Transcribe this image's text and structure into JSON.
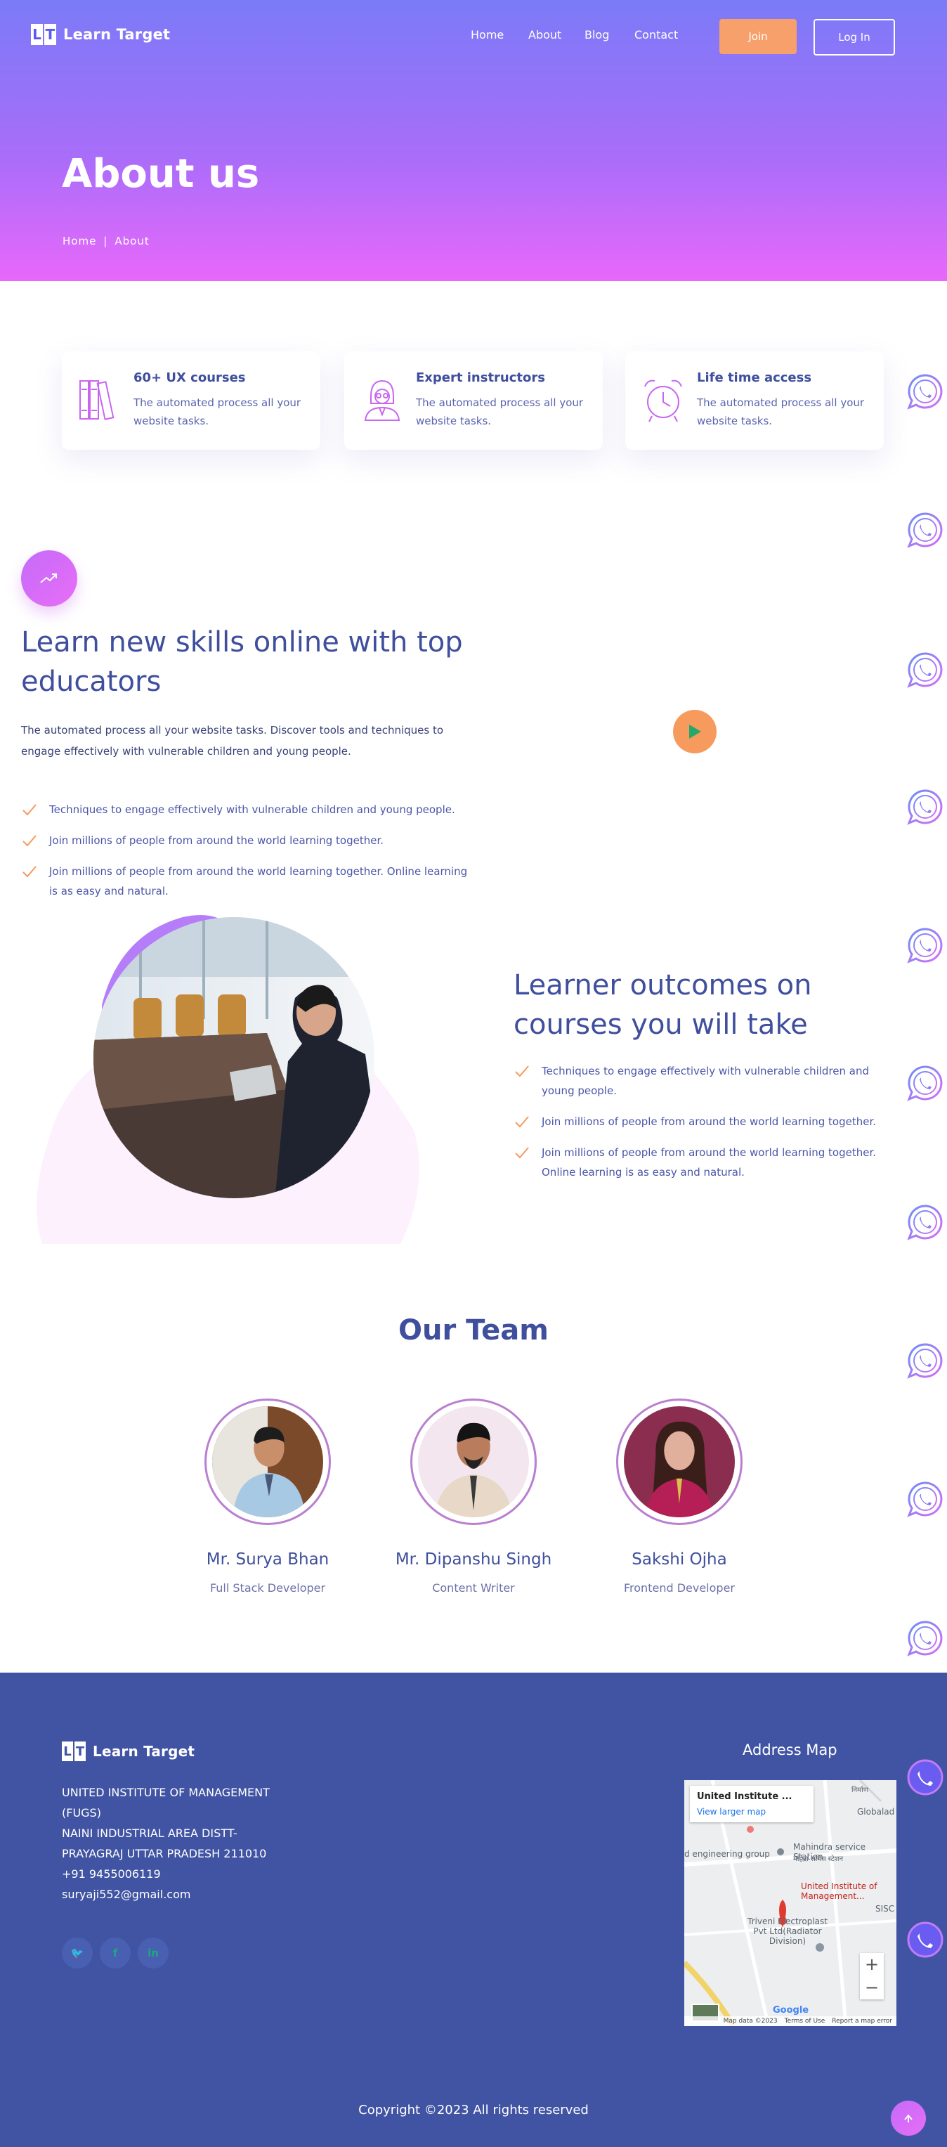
{
  "brand": {
    "logo_letters": [
      "L",
      "T"
    ],
    "name": "Learn Target"
  },
  "nav": {
    "items": [
      "Home",
      "About",
      "Blog",
      "Contact"
    ],
    "join": "Join",
    "login": "Log In"
  },
  "hero": {
    "title": "About us",
    "breadcrumb": [
      "Home",
      "|",
      "About"
    ]
  },
  "features": [
    {
      "title": "60+ UX courses",
      "text": "The automated process all your website tasks.",
      "icon": "books-icon"
    },
    {
      "title": "Expert instructors",
      "text": "The automated process all your website tasks.",
      "icon": "instructor-icon"
    },
    {
      "title": "Life time access",
      "text": "The automated process all your website tasks.",
      "icon": "alarm-clock-icon"
    }
  ],
  "skills": {
    "title": "Learn new skills online with top educators",
    "desc": "The automated process all your website tasks. Discover tools and techniques to engage effectively with vulnerable children and young people.",
    "points": [
      "Techniques to engage effectively with vulnerable children and young people.",
      "Join millions of people from around the world learning together.",
      "Join millions of people from around the world learning together. Online learning is as easy and natural."
    ]
  },
  "outcomes": {
    "title": "Learner outcomes on courses you will take",
    "points": [
      "Techniques to engage effectively with vulnerable children and young people.",
      "Join millions of people from around the world learning together.",
      "Join millions of people from around the world learning together. Online learning is as easy and natural."
    ]
  },
  "team": {
    "title": "Our Team",
    "members": [
      {
        "name": "Mr. Surya Bhan",
        "role": "Full Stack Developer"
      },
      {
        "name": "Mr. Dipanshu Singh",
        "role": "Content Writer"
      },
      {
        "name": "Sakshi Ojha",
        "role": "Frontend Developer"
      }
    ]
  },
  "footer": {
    "address_lines": [
      "UNITED INSTITUTE OF MANAGEMENT (FUGS)",
      "NAINI INDUSTRIAL AREA DISTT- PRAYAGRAJ UTTAR PRADESH 211010",
      "+91 9455006119",
      "suryaji552@gmail.com"
    ],
    "socials": [
      "twitter-icon",
      "facebook-icon",
      "linkedin-icon"
    ],
    "social_glyphs": [
      "🐦",
      "f",
      "in"
    ],
    "map_title": "Address Map",
    "map": {
      "place_title": "United Institute ...",
      "view_larger": "View larger map",
      "labels": [
        "Mahindra service Station",
        "महिंद्रा सर्विस स्टेशन",
        "d engineering group",
        "Globalad",
        "United Institute of Management...",
        "Triveni Electroplast Pvt Ltd(Radiator Division)",
        "SISC",
        "निर्माण"
      ],
      "attribution": [
        "Google",
        "Map data ©2023",
        "Terms of Use",
        "Report a map error"
      ],
      "zoom": [
        "+",
        "−"
      ]
    },
    "copyright": "Copyright ©2023 All rights reserved"
  },
  "colors": {
    "brand": "#4054a3",
    "accent": "#f7a06b",
    "gradient_start": "#7b7bf7",
    "gradient_end": "#e868fb"
  }
}
